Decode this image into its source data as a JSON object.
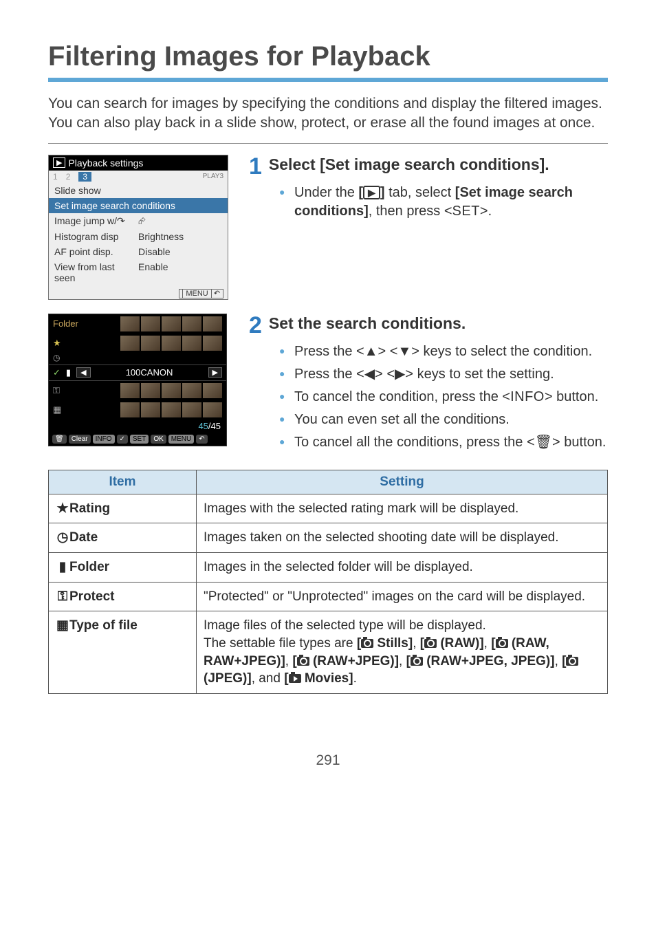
{
  "title": "Filtering Images for Playback",
  "intro": "You can search for images by specifying the conditions and display the filtered images. You can also play back in a slide show, protect, or erase all the found images at once.",
  "menu": {
    "header": "Playback settings",
    "tabs": [
      "1",
      "2",
      "3"
    ],
    "play_tag": "PLAY3",
    "items": {
      "slide": "Slide show",
      "search": "Set image search conditions",
      "jump_l": "Image jump w/",
      "jump_r": "",
      "hist_l": "Histogram disp",
      "hist_r": "Brightness",
      "af_l": "AF point disp.",
      "af_r": "Disable",
      "view_l": "View from last seen",
      "view_r": "Enable",
      "footer": "MENU"
    }
  },
  "folder": {
    "label": "Folder",
    "current": "100CANON",
    "count_a": "45",
    "count_sep": "/",
    "count_b": "45",
    "btns": [
      "Clear",
      "INFO",
      "✓",
      "SET",
      "OK",
      "MENU"
    ]
  },
  "step1": {
    "num": "1",
    "title": "Select [Set image search conditions].",
    "bullet_pre": "Under the ",
    "bullet_mid1": " tab, select ",
    "bullet_bold": "[Set image search conditions]",
    "bullet_mid2": ", then press <",
    "bullet_key": "SET",
    "bullet_end": ">."
  },
  "step2": {
    "num": "2",
    "title": "Set the search conditions.",
    "b1a": "Press the <",
    "b1b": "> <",
    "b1c": "> keys to select the condition.",
    "b2a": "Press the <",
    "b2b": "> <",
    "b2c": "> keys to set the setting.",
    "b3a": "To cancel the condition, press the <",
    "b3key": "INFO",
    "b3b": "> button.",
    "b4": "You can even set all the conditions.",
    "b5a": "To cancel all the conditions, press the <",
    "b5b": "> button."
  },
  "table": {
    "h1": "Item",
    "h2": "Setting",
    "rows": {
      "rating": {
        "n": "Rating",
        "d": "Images with the selected rating mark will be displayed."
      },
      "date": {
        "n": "Date",
        "d": "Images taken on the selected shooting date will be displayed."
      },
      "folder": {
        "n": "Folder",
        "d": "Images in the selected folder will be displayed."
      },
      "protect": {
        "n": "Protect",
        "d": "\"Protected\" or \"Unprotected\" images on the card will be displayed."
      },
      "type": {
        "n": "Type of file",
        "d1": "Image files of the selected type will be displayed.",
        "d2a": "The settable file types are ",
        "opt1": " Stills]",
        "opt2": " (RAW)]",
        "opt3": " (RAW, RAW+JPEG)]",
        "opt4": " (RAW+JPEG)]",
        "opt5": " (RAW+JPEG, JPEG)]",
        "opt6": " (JPEG)]",
        "d2b": ", and ",
        "opt7": " Movies]",
        "period": "."
      }
    }
  },
  "page_num": "291"
}
